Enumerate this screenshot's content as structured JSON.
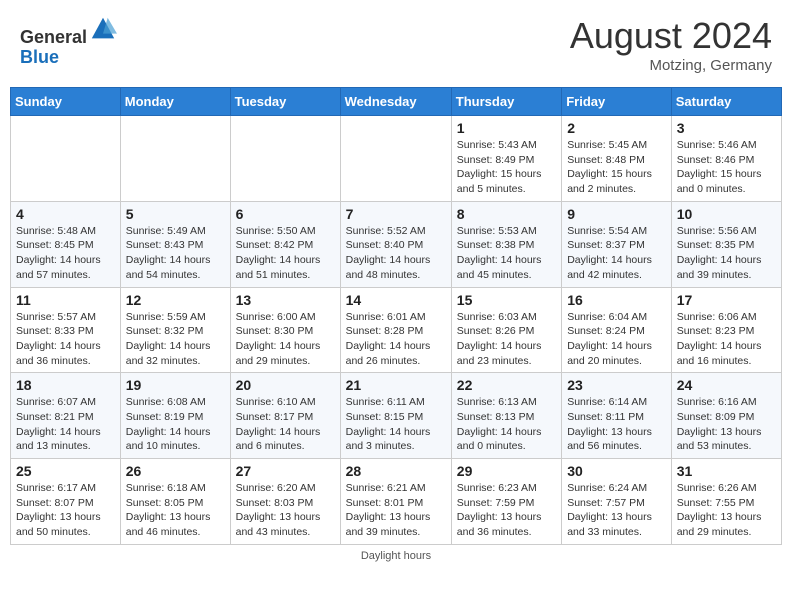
{
  "header": {
    "logo_line1": "General",
    "logo_line2": "Blue",
    "month": "August 2024",
    "location": "Motzing, Germany"
  },
  "weekdays": [
    "Sunday",
    "Monday",
    "Tuesday",
    "Wednesday",
    "Thursday",
    "Friday",
    "Saturday"
  ],
  "footer": "Daylight hours",
  "weeks": [
    [
      {
        "day": "",
        "info": ""
      },
      {
        "day": "",
        "info": ""
      },
      {
        "day": "",
        "info": ""
      },
      {
        "day": "",
        "info": ""
      },
      {
        "day": "1",
        "info": "Sunrise: 5:43 AM\nSunset: 8:49 PM\nDaylight: 15 hours\nand 5 minutes."
      },
      {
        "day": "2",
        "info": "Sunrise: 5:45 AM\nSunset: 8:48 PM\nDaylight: 15 hours\nand 2 minutes."
      },
      {
        "day": "3",
        "info": "Sunrise: 5:46 AM\nSunset: 8:46 PM\nDaylight: 15 hours\nand 0 minutes."
      }
    ],
    [
      {
        "day": "4",
        "info": "Sunrise: 5:48 AM\nSunset: 8:45 PM\nDaylight: 14 hours\nand 57 minutes."
      },
      {
        "day": "5",
        "info": "Sunrise: 5:49 AM\nSunset: 8:43 PM\nDaylight: 14 hours\nand 54 minutes."
      },
      {
        "day": "6",
        "info": "Sunrise: 5:50 AM\nSunset: 8:42 PM\nDaylight: 14 hours\nand 51 minutes."
      },
      {
        "day": "7",
        "info": "Sunrise: 5:52 AM\nSunset: 8:40 PM\nDaylight: 14 hours\nand 48 minutes."
      },
      {
        "day": "8",
        "info": "Sunrise: 5:53 AM\nSunset: 8:38 PM\nDaylight: 14 hours\nand 45 minutes."
      },
      {
        "day": "9",
        "info": "Sunrise: 5:54 AM\nSunset: 8:37 PM\nDaylight: 14 hours\nand 42 minutes."
      },
      {
        "day": "10",
        "info": "Sunrise: 5:56 AM\nSunset: 8:35 PM\nDaylight: 14 hours\nand 39 minutes."
      }
    ],
    [
      {
        "day": "11",
        "info": "Sunrise: 5:57 AM\nSunset: 8:33 PM\nDaylight: 14 hours\nand 36 minutes."
      },
      {
        "day": "12",
        "info": "Sunrise: 5:59 AM\nSunset: 8:32 PM\nDaylight: 14 hours\nand 32 minutes."
      },
      {
        "day": "13",
        "info": "Sunrise: 6:00 AM\nSunset: 8:30 PM\nDaylight: 14 hours\nand 29 minutes."
      },
      {
        "day": "14",
        "info": "Sunrise: 6:01 AM\nSunset: 8:28 PM\nDaylight: 14 hours\nand 26 minutes."
      },
      {
        "day": "15",
        "info": "Sunrise: 6:03 AM\nSunset: 8:26 PM\nDaylight: 14 hours\nand 23 minutes."
      },
      {
        "day": "16",
        "info": "Sunrise: 6:04 AM\nSunset: 8:24 PM\nDaylight: 14 hours\nand 20 minutes."
      },
      {
        "day": "17",
        "info": "Sunrise: 6:06 AM\nSunset: 8:23 PM\nDaylight: 14 hours\nand 16 minutes."
      }
    ],
    [
      {
        "day": "18",
        "info": "Sunrise: 6:07 AM\nSunset: 8:21 PM\nDaylight: 14 hours\nand 13 minutes."
      },
      {
        "day": "19",
        "info": "Sunrise: 6:08 AM\nSunset: 8:19 PM\nDaylight: 14 hours\nand 10 minutes."
      },
      {
        "day": "20",
        "info": "Sunrise: 6:10 AM\nSunset: 8:17 PM\nDaylight: 14 hours\nand 6 minutes."
      },
      {
        "day": "21",
        "info": "Sunrise: 6:11 AM\nSunset: 8:15 PM\nDaylight: 14 hours\nand 3 minutes."
      },
      {
        "day": "22",
        "info": "Sunrise: 6:13 AM\nSunset: 8:13 PM\nDaylight: 14 hours\nand 0 minutes."
      },
      {
        "day": "23",
        "info": "Sunrise: 6:14 AM\nSunset: 8:11 PM\nDaylight: 13 hours\nand 56 minutes."
      },
      {
        "day": "24",
        "info": "Sunrise: 6:16 AM\nSunset: 8:09 PM\nDaylight: 13 hours\nand 53 minutes."
      }
    ],
    [
      {
        "day": "25",
        "info": "Sunrise: 6:17 AM\nSunset: 8:07 PM\nDaylight: 13 hours\nand 50 minutes."
      },
      {
        "day": "26",
        "info": "Sunrise: 6:18 AM\nSunset: 8:05 PM\nDaylight: 13 hours\nand 46 minutes."
      },
      {
        "day": "27",
        "info": "Sunrise: 6:20 AM\nSunset: 8:03 PM\nDaylight: 13 hours\nand 43 minutes."
      },
      {
        "day": "28",
        "info": "Sunrise: 6:21 AM\nSunset: 8:01 PM\nDaylight: 13 hours\nand 39 minutes."
      },
      {
        "day": "29",
        "info": "Sunrise: 6:23 AM\nSunset: 7:59 PM\nDaylight: 13 hours\nand 36 minutes."
      },
      {
        "day": "30",
        "info": "Sunrise: 6:24 AM\nSunset: 7:57 PM\nDaylight: 13 hours\nand 33 minutes."
      },
      {
        "day": "31",
        "info": "Sunrise: 6:26 AM\nSunset: 7:55 PM\nDaylight: 13 hours\nand 29 minutes."
      }
    ]
  ]
}
